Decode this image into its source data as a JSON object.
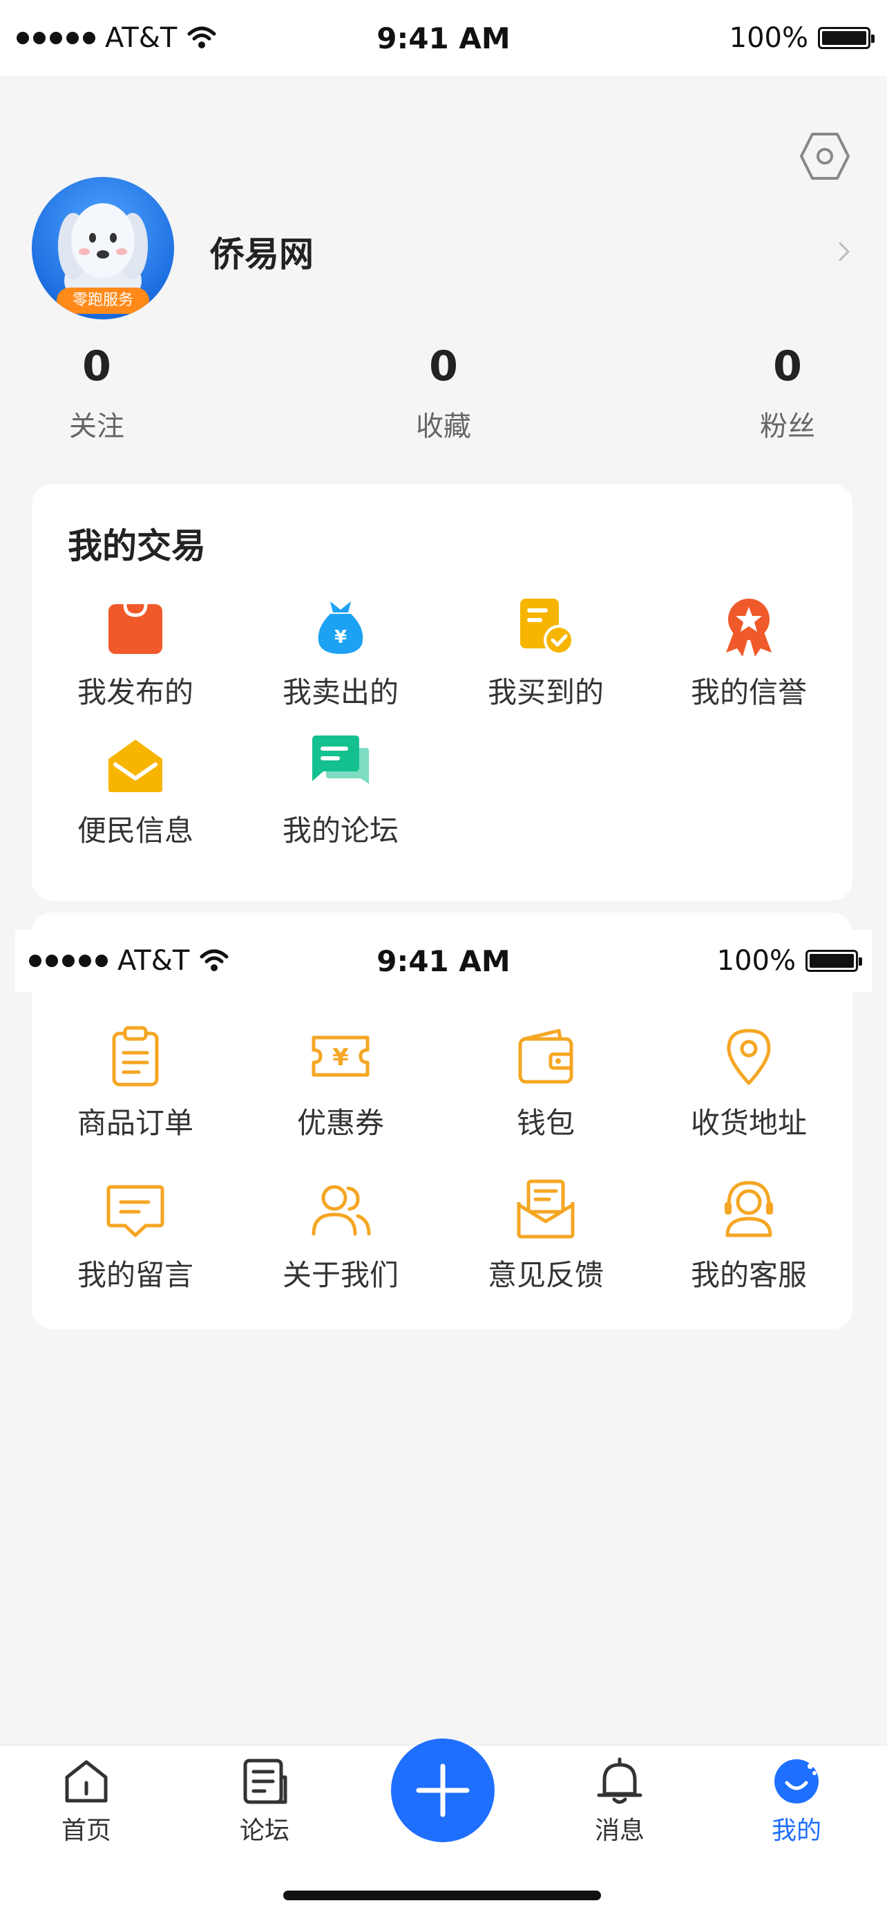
{
  "status_bar": {
    "carrier": "AT&T",
    "time": "9:41 AM",
    "battery": "100%"
  },
  "profile": {
    "name": "侨易网",
    "avatar_badge": "零跑服务"
  },
  "stats": [
    {
      "value": "0",
      "label": "关注"
    },
    {
      "value": "0",
      "label": "收藏"
    },
    {
      "value": "0",
      "label": "粉丝"
    }
  ],
  "my_trades": {
    "title": "我的交易",
    "items": [
      {
        "label": "我发布的",
        "icon": "shopping-bag-icon"
      },
      {
        "label": "我卖出的",
        "icon": "money-bag-icon"
      },
      {
        "label": "我买到的",
        "icon": "receipt-check-icon"
      },
      {
        "label": "我的信誉",
        "icon": "medal-icon"
      },
      {
        "label": "便民信息",
        "icon": "envelope-icon"
      },
      {
        "label": "我的论坛",
        "icon": "chat-icon"
      }
    ]
  },
  "services": {
    "items": [
      {
        "label": "商品订单",
        "icon": "clipboard-icon"
      },
      {
        "label": "优惠券",
        "icon": "coupon-icon"
      },
      {
        "label": "钱包",
        "icon": "wallet-icon"
      },
      {
        "label": "收货地址",
        "icon": "location-pin-icon"
      },
      {
        "label": "我的留言",
        "icon": "message-icon"
      },
      {
        "label": "关于我们",
        "icon": "users-icon"
      },
      {
        "label": "意见反馈",
        "icon": "mail-open-icon"
      },
      {
        "label": "我的客服",
        "icon": "headset-icon"
      }
    ]
  },
  "tabbar": {
    "items": [
      {
        "label": "首页",
        "icon": "home-icon"
      },
      {
        "label": "论坛",
        "icon": "document-icon"
      },
      {
        "label": "",
        "icon": "plus-icon"
      },
      {
        "label": "消息",
        "icon": "bell-icon"
      },
      {
        "label": "我的",
        "icon": "profile-icon",
        "active": true
      }
    ]
  },
  "colors": {
    "accent": "#1f6fff",
    "orange": "#f5a623",
    "red": "#f05a2a"
  }
}
